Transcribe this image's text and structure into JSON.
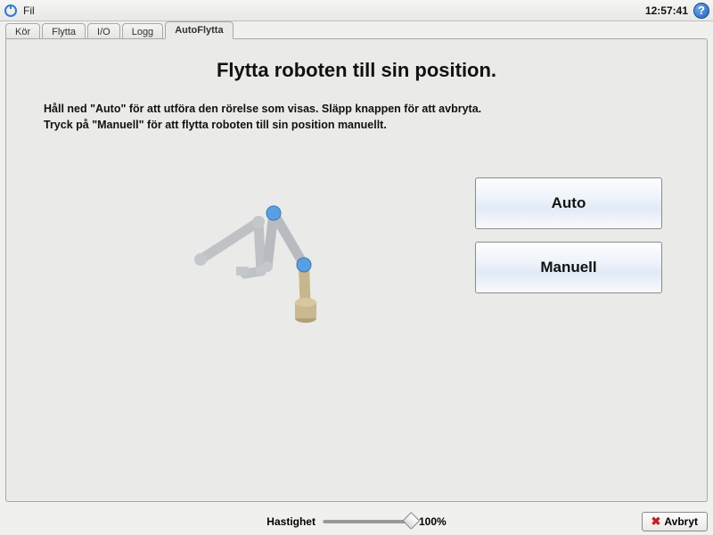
{
  "titlebar": {
    "file_menu": "Fil",
    "clock": "12:57:41"
  },
  "tabs": [
    {
      "label": "Kör"
    },
    {
      "label": "Flytta"
    },
    {
      "label": "I/O"
    },
    {
      "label": "Logg"
    },
    {
      "label": "AutoFlytta",
      "active": true
    }
  ],
  "main": {
    "heading": "Flytta roboten till sin position.",
    "instruction_line1": "Håll ned \"Auto\" för att utföra den rörelse som visas. Släpp knappen för att avbryta.",
    "instruction_line2": "Tryck på \"Manuell\" för att flytta roboten till sin position manuellt.",
    "auto_button": "Auto",
    "manual_button": "Manuell"
  },
  "footer": {
    "speed_label": "Hastighet",
    "speed_value": "100%",
    "cancel_label": "Avbryt"
  }
}
